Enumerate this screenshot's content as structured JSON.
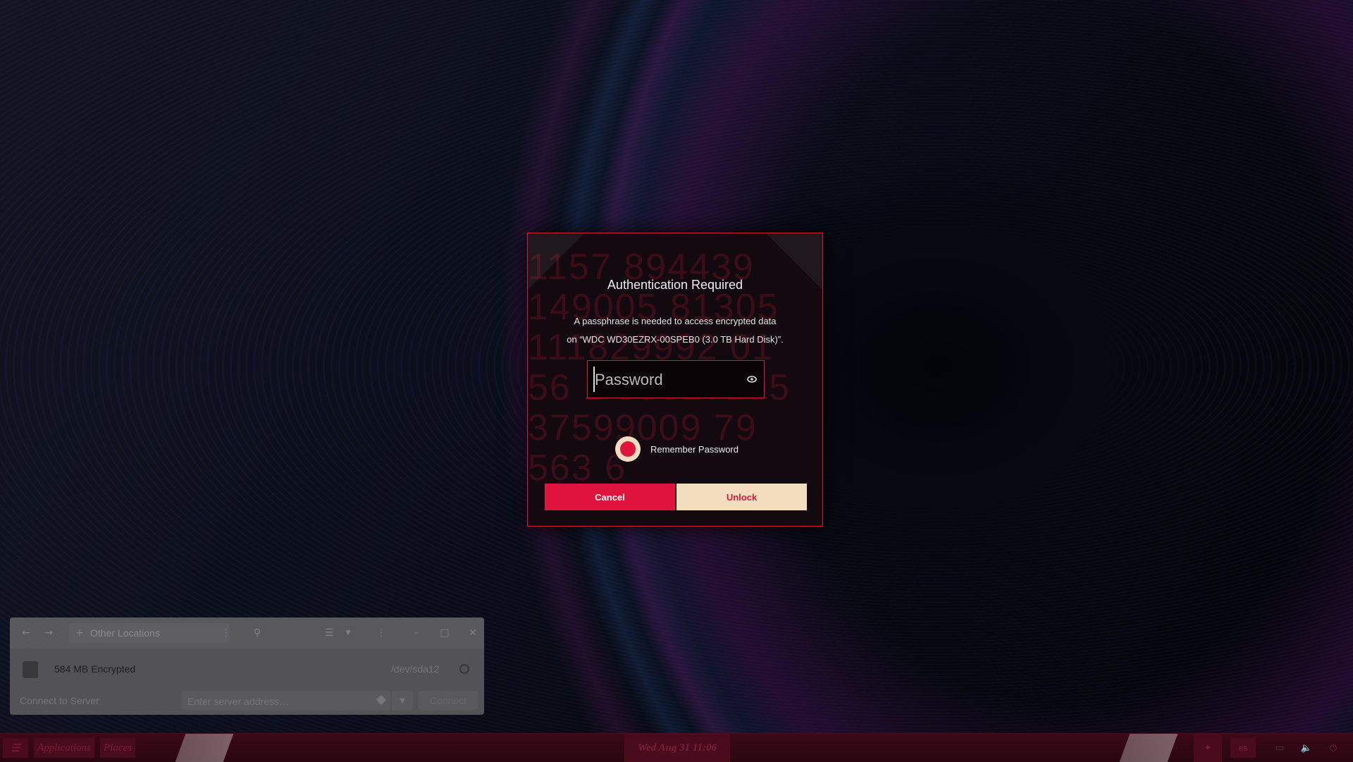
{
  "dialog": {
    "title": "Authentication Required",
    "message_line1": "A passphrase is needed to access encrypted data",
    "message_line2": "on “WDC WD30EZRX-00SPEB0 (3.0 TB Hard Disk)”.",
    "password_placeholder": "Password",
    "password_value": "",
    "remember_label": "Remember Password",
    "remember_checked": true,
    "cancel_label": "Cancel",
    "unlock_label": "Unlock",
    "decor_text": "1157 894439\n149005 81305\n111829992 01\n56 1 39017195\n37599009 79\n563 6"
  },
  "file_manager": {
    "location": "Other Locations",
    "drive": {
      "name": "584 MB Encrypted",
      "device": "/dev/sda12"
    },
    "connect_label": "Connect to Server",
    "server_placeholder": "Enter server address…",
    "connect_button": "Connect"
  },
  "taskbar": {
    "applications": "Applications",
    "places": "Places",
    "clock": "Wed Aug 31  11:06",
    "keyboard_layout": "es"
  },
  "colors": {
    "accent": "#e0143c",
    "cream": "#f3dfbf",
    "dialog_bg": "#120a0e",
    "taskbar_bg": "#3a0a16"
  }
}
